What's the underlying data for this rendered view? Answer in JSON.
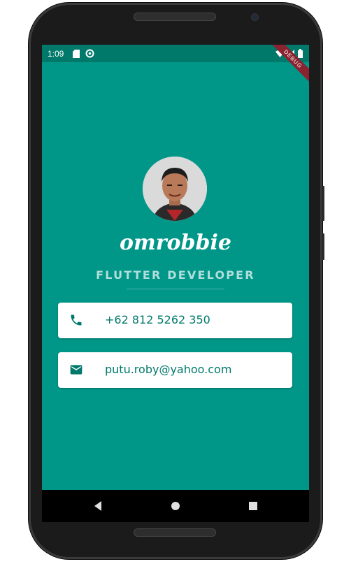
{
  "status_bar": {
    "time": "1:09",
    "left_icons": [
      "sd-card-icon",
      "data-saver-icon"
    ],
    "right_icons": [
      "wifi-icon",
      "signal-icon",
      "battery-icon"
    ],
    "debug_banner": "DEBUG"
  },
  "profile": {
    "name": "omrobbie",
    "role": "FLUTTER DEVELOPER"
  },
  "contacts": [
    {
      "icon": "phone-icon",
      "text": "+62 812 5262 350"
    },
    {
      "icon": "email-icon",
      "text": "putu.roby@yahoo.com"
    }
  ],
  "nav_bar": {
    "buttons": [
      "back-icon",
      "home-icon",
      "recents-icon"
    ]
  },
  "colors": {
    "primary": "#009688",
    "status_bar": "#00796b",
    "role_text": "#b2dfdb",
    "contact_text": "#00796b",
    "card_bg": "#ffffff"
  }
}
